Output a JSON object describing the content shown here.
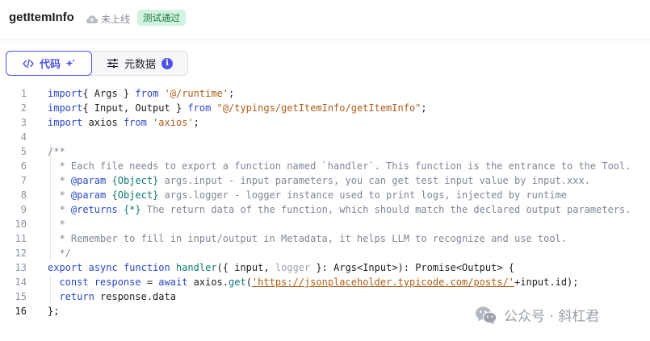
{
  "header": {
    "title": "getItemInfo",
    "status_label": "未上线",
    "badge_label": "测试通过"
  },
  "tabs": {
    "code_label": "代码",
    "meta_label": "元数据",
    "meta_info": "i"
  },
  "code": {
    "line_numbers": [
      "1",
      "2",
      "3",
      "4",
      "5",
      "6",
      "7",
      "8",
      "9",
      "10",
      "11",
      "12",
      "13",
      "14",
      "15",
      "16"
    ],
    "lines": [
      [
        [
          "kw",
          "import"
        ],
        [
          "",
          "{ Args } "
        ],
        [
          "kw",
          "from"
        ],
        [
          "",
          " "
        ],
        [
          "str",
          "'@/runtime'"
        ],
        [
          "",
          ";"
        ]
      ],
      [
        [
          "kw",
          "import"
        ],
        [
          "",
          "{ Input, Output } "
        ],
        [
          "kw",
          "from"
        ],
        [
          "",
          " "
        ],
        [
          "str",
          "\"@/typings/getItemInfo/getItemInfo\""
        ],
        [
          "",
          ";"
        ]
      ],
      [
        [
          "kw",
          "import"
        ],
        [
          "",
          " axios "
        ],
        [
          "kw",
          "from"
        ],
        [
          "",
          " "
        ],
        [
          "str",
          "'axios'"
        ],
        [
          "",
          ";"
        ]
      ],
      [],
      [
        [
          "cm",
          "/**"
        ]
      ],
      [
        [
          "cm",
          "  * Each file needs to export a function named `handler`. This function is the entrance to the Tool."
        ]
      ],
      [
        [
          "cm",
          "  * "
        ],
        [
          "tag",
          "@param"
        ],
        [
          "cm",
          " "
        ],
        [
          "type",
          "{Object}"
        ],
        [
          "cm",
          " args.input - input parameters, you can get test input value by input.xxx."
        ]
      ],
      [
        [
          "cm",
          "  * "
        ],
        [
          "tag",
          "@param"
        ],
        [
          "cm",
          " "
        ],
        [
          "type",
          "{Object}"
        ],
        [
          "cm",
          " args.logger - logger instance used to print logs, injected by runtime"
        ]
      ],
      [
        [
          "cm",
          "  * "
        ],
        [
          "tag",
          "@returns"
        ],
        [
          "cm",
          " "
        ],
        [
          "type",
          "{*}"
        ],
        [
          "cm",
          " The return data of the function, which should match the declared output parameters."
        ]
      ],
      [
        [
          "cm",
          "  *"
        ]
      ],
      [
        [
          "cm",
          "  * Remember to fill in input/output in Metadata, it helps LLM to recognize and use tool."
        ]
      ],
      [
        [
          "cm",
          "  */"
        ]
      ],
      [
        [
          "kw",
          "export"
        ],
        [
          "",
          " "
        ],
        [
          "kw",
          "async"
        ],
        [
          "",
          " "
        ],
        [
          "kw",
          "function"
        ],
        [
          "",
          " "
        ],
        [
          "type",
          "handler"
        ],
        [
          "",
          "({ input, "
        ],
        [
          "dim",
          "logger"
        ],
        [
          "",
          " }: Args<Input>): Promise<Output> {"
        ]
      ],
      [
        [
          "",
          "  "
        ],
        [
          "kw",
          "const"
        ],
        [
          "",
          " "
        ],
        [
          "kw",
          "response"
        ],
        [
          "",
          " = "
        ],
        [
          "kw",
          "await"
        ],
        [
          "",
          " axios."
        ],
        [
          "type",
          "get"
        ],
        [
          "",
          "("
        ],
        [
          "url",
          "'https://jsonplaceholder.typicode.com/posts/'"
        ],
        [
          "",
          "+input.id);"
        ]
      ],
      [
        [
          "",
          "  "
        ],
        [
          "kw",
          "return"
        ],
        [
          "",
          " response.data"
        ]
      ],
      [
        [
          "",
          "};"
        ]
      ]
    ]
  },
  "watermark": {
    "text": "公众号 · 斜杠君"
  },
  "colors": {
    "accent": "#4d53e8",
    "badge_bg": "#d2f3df",
    "badge_text": "#197a3c"
  }
}
